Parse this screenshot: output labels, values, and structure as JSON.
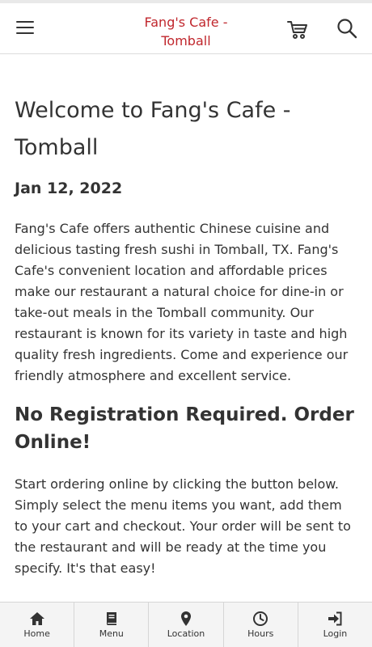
{
  "header": {
    "brand_line1": "Fang's Cafe -",
    "brand_line2": "Tomball",
    "icons": [
      "menu-icon",
      "cart-icon",
      "search-icon"
    ],
    "brand_color": "#c0272d"
  },
  "main": {
    "title": "Welcome to Fang's Cafe - Tomball",
    "date": "Jan 12, 2022",
    "intro": "Fang's Cafe offers authentic Chinese cuisine and delicious tasting fresh sushi in Tomball, TX. Fang's Cafe's convenient location and affordable prices make our restaurant a natural choice for dine-in or take-out meals in the Tomball community. Our restaurant is known for its variety in taste and high quality fresh ingredients. Come and experience our friendly atmosphere and excellent service.",
    "subheading": "No Registration Required. Order Online!",
    "instructions": "Start ordering online by clicking the button below. Simply select the menu items you want, add them to your cart and checkout. Your order will be sent to the restaurant and will be ready at the time you specify. It's that easy!"
  },
  "bottom_nav": {
    "items": [
      {
        "label": "Home",
        "icon": "home-icon"
      },
      {
        "label": "Menu",
        "icon": "book-icon"
      },
      {
        "label": "Location",
        "icon": "map-pin-icon"
      },
      {
        "label": "Hours",
        "icon": "clock-icon"
      },
      {
        "label": "Login",
        "icon": "login-icon"
      }
    ]
  }
}
